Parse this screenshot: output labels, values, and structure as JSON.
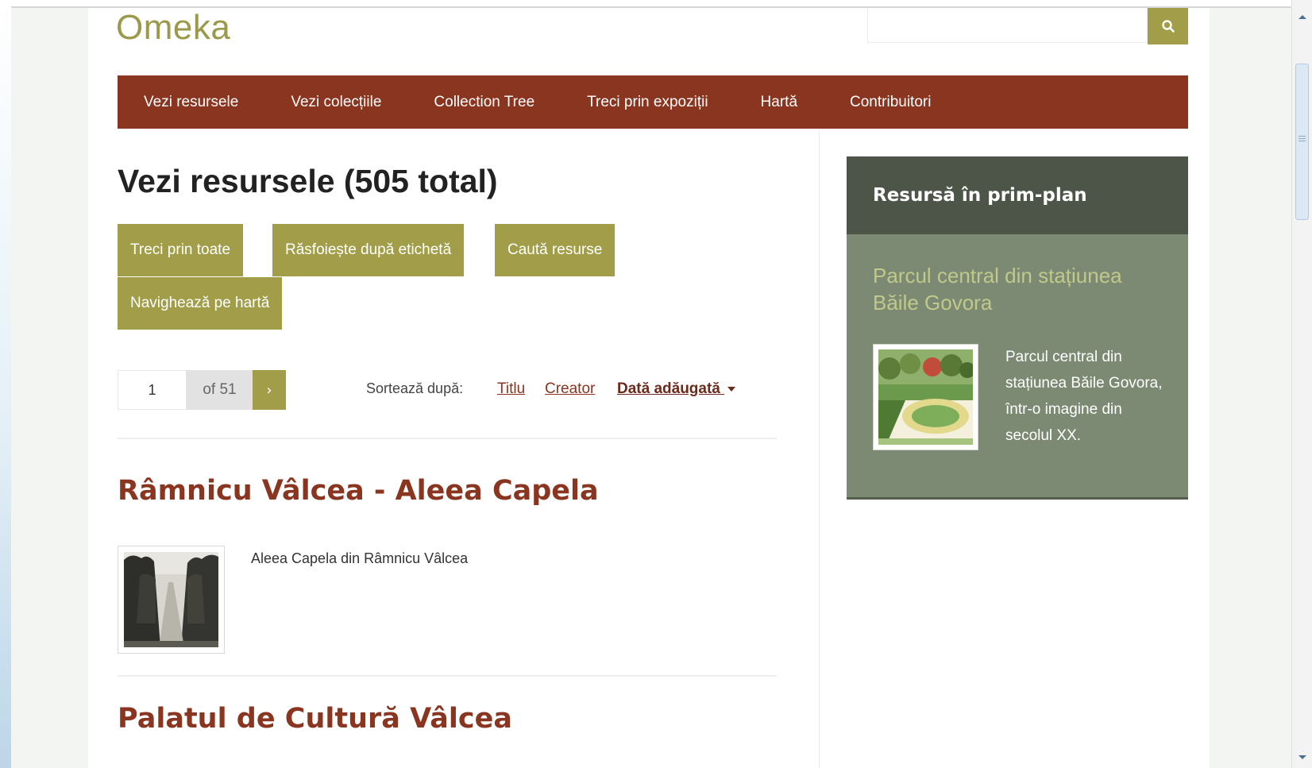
{
  "header": {
    "logo": "Omeka",
    "search": {
      "value": "",
      "placeholder": ""
    }
  },
  "nav": {
    "items": [
      "Vezi resursele",
      "Vezi colecțiile",
      "Collection Tree",
      "Treci prin expoziții",
      "Hartă",
      "Contribuitori"
    ]
  },
  "main": {
    "title": "Vezi resursele (505 total)",
    "actions": {
      "browse_all": "Treci prin toate",
      "browse_tags": "Răsfoiește după etichetă",
      "search_items": "Caută resurse",
      "map": "Navighează pe hartă"
    },
    "pagination": {
      "page": "1",
      "of_label": "of 51",
      "next": "›"
    },
    "sort": {
      "label": "Sortează după:",
      "options": [
        "Titlu",
        "Creator",
        "Dată adăugată"
      ],
      "active": "Dată adăugată",
      "direction_icon": "caret-down-icon"
    },
    "items": [
      {
        "title": "Râmnicu Vâlcea - Aleea Capela",
        "description": "Aleea Capela din Râmnicu Vâlcea"
      },
      {
        "title": "Palatul de Cultură Vâlcea",
        "description": ""
      }
    ]
  },
  "sidebar": {
    "featured": {
      "heading": "Resursă în prim-plan",
      "title": "Parcul central din stațiunea Băile Govora",
      "description": "Parcul central din stațiunea Băile Govora, într-o imagine din secolul XX."
    }
  },
  "colors": {
    "nav_bg": "#8a3520",
    "accent_olive": "#a19d49",
    "link_brown": "#8a3520",
    "featured_bg": "#7c8a73",
    "featured_head_bg": "#4c5548",
    "featured_title": "#c0c98a"
  },
  "icons": {
    "search": "search-icon",
    "next": "chevron-right-icon",
    "scroll_up": "scroll-up-arrow-icon",
    "scroll_down": "scroll-down-arrow-icon"
  }
}
